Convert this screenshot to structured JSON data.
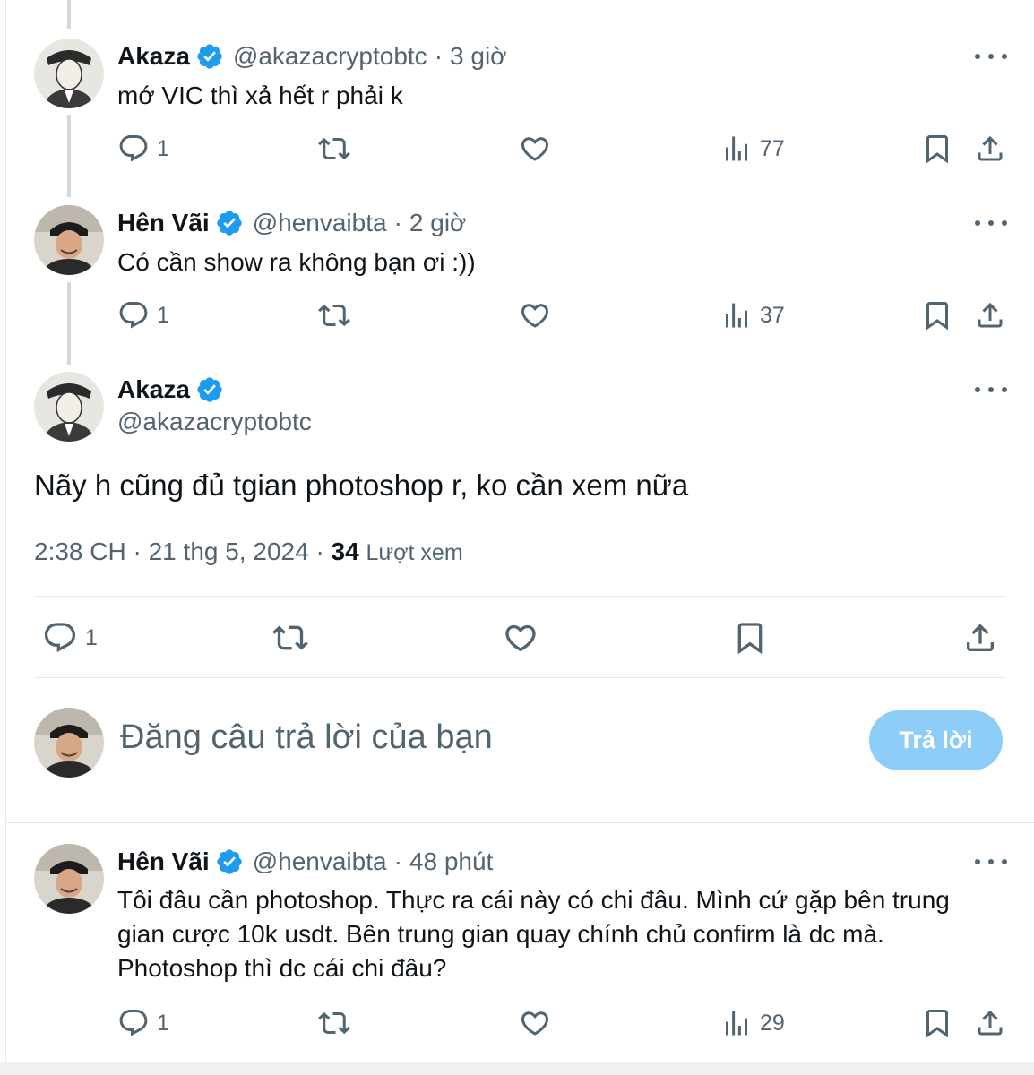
{
  "accent": "#1d9bf0",
  "thread": [
    {
      "name": "Akaza",
      "handle": "@akazacryptobtc",
      "separator": "·",
      "time": "3 giờ",
      "text": "mớ VIC thì xả hết r phải k",
      "replies": "1",
      "views": "77"
    },
    {
      "name": "Hên Vãi",
      "handle": "@henvaibta",
      "separator": "·",
      "time": "2 giờ",
      "text": "Có cần show ra không bạn ơi :))",
      "replies": "1",
      "views": "37"
    }
  ],
  "main_post": {
    "name": "Akaza",
    "handle": "@akazacryptobtc",
    "text": "Nãy h cũng đủ tgian photoshop r, ko cần xem nữa",
    "time": "2:38 CH",
    "date": "21 thg 5, 2024",
    "separator": "·",
    "views_count": "34",
    "views_label": "Lượt xem",
    "replies": "1"
  },
  "composer": {
    "placeholder": "Đăng câu trả lời của bạn",
    "button": "Trả lời"
  },
  "reply": {
    "name": "Hên Vãi",
    "handle": "@henvaibta",
    "separator": "·",
    "time": "48 phút",
    "text_lines": [
      "Tôi đâu cần photoshop. Thực ra cái này có chi đâu. Mình cứ gặp bên trung",
      "gian cược 10k usdt. Bên trung gian quay chính chủ confirm là dc mà.",
      "Photoshop thì dc cái chi đâu?"
    ],
    "replies": "1",
    "views": "29"
  }
}
